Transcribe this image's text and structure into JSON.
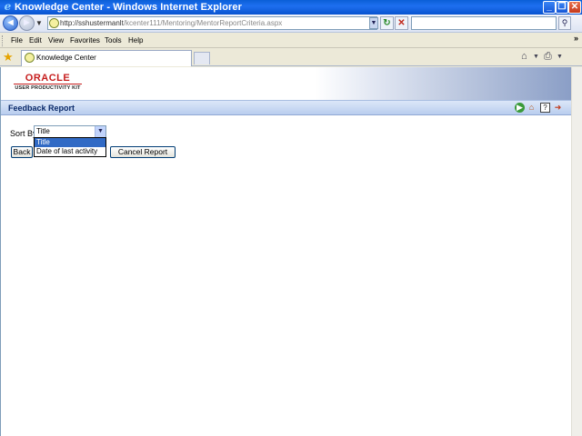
{
  "window": {
    "title": "Knowledge Center - Windows Internet Explorer"
  },
  "address": {
    "url_host": "http://sshustermanlt",
    "url_path": "/kcenter111/Mentoring/MentorReportCriteria.aspx"
  },
  "menu": {
    "items": [
      "File",
      "Edit",
      "View",
      "Favorites",
      "Tools",
      "Help"
    ]
  },
  "tab": {
    "label": "Knowledge Center"
  },
  "logo": {
    "brand": "ORACLE",
    "sub": "USER PRODUCTIVITY KIT"
  },
  "report": {
    "title": "Feedback Report",
    "sort_label": "Sort By",
    "sort_selected": "Title",
    "sort_options": [
      "Title",
      "Date of last activity"
    ],
    "back_label": "Back",
    "cancel_label": "Cancel Report"
  },
  "colors": {
    "titlebar": "#0a5fd6",
    "section_bar": "#b9cdee",
    "oracle_red": "#c61d1d",
    "selection": "#316ac5"
  }
}
